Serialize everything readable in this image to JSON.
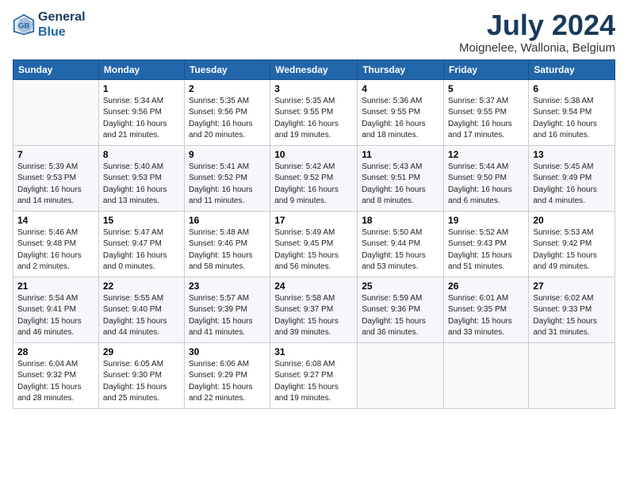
{
  "header": {
    "logo_line1": "General",
    "logo_line2": "Blue",
    "title": "July 2024",
    "location": "Moignelee, Wallonia, Belgium"
  },
  "columns": [
    "Sunday",
    "Monday",
    "Tuesday",
    "Wednesday",
    "Thursday",
    "Friday",
    "Saturday"
  ],
  "weeks": [
    [
      {
        "day": "",
        "info": ""
      },
      {
        "day": "1",
        "info": "Sunrise: 5:34 AM\nSunset: 9:56 PM\nDaylight: 16 hours\nand 21 minutes."
      },
      {
        "day": "2",
        "info": "Sunrise: 5:35 AM\nSunset: 9:56 PM\nDaylight: 16 hours\nand 20 minutes."
      },
      {
        "day": "3",
        "info": "Sunrise: 5:35 AM\nSunset: 9:55 PM\nDaylight: 16 hours\nand 19 minutes."
      },
      {
        "day": "4",
        "info": "Sunrise: 5:36 AM\nSunset: 9:55 PM\nDaylight: 16 hours\nand 18 minutes."
      },
      {
        "day": "5",
        "info": "Sunrise: 5:37 AM\nSunset: 9:55 PM\nDaylight: 16 hours\nand 17 minutes."
      },
      {
        "day": "6",
        "info": "Sunrise: 5:38 AM\nSunset: 9:54 PM\nDaylight: 16 hours\nand 16 minutes."
      }
    ],
    [
      {
        "day": "7",
        "info": "Sunrise: 5:39 AM\nSunset: 9:53 PM\nDaylight: 16 hours\nand 14 minutes."
      },
      {
        "day": "8",
        "info": "Sunrise: 5:40 AM\nSunset: 9:53 PM\nDaylight: 16 hours\nand 13 minutes."
      },
      {
        "day": "9",
        "info": "Sunrise: 5:41 AM\nSunset: 9:52 PM\nDaylight: 16 hours\nand 11 minutes."
      },
      {
        "day": "10",
        "info": "Sunrise: 5:42 AM\nSunset: 9:52 PM\nDaylight: 16 hours\nand 9 minutes."
      },
      {
        "day": "11",
        "info": "Sunrise: 5:43 AM\nSunset: 9:51 PM\nDaylight: 16 hours\nand 8 minutes."
      },
      {
        "day": "12",
        "info": "Sunrise: 5:44 AM\nSunset: 9:50 PM\nDaylight: 16 hours\nand 6 minutes."
      },
      {
        "day": "13",
        "info": "Sunrise: 5:45 AM\nSunset: 9:49 PM\nDaylight: 16 hours\nand 4 minutes."
      }
    ],
    [
      {
        "day": "14",
        "info": "Sunrise: 5:46 AM\nSunset: 9:48 PM\nDaylight: 16 hours\nand 2 minutes."
      },
      {
        "day": "15",
        "info": "Sunrise: 5:47 AM\nSunset: 9:47 PM\nDaylight: 16 hours\nand 0 minutes."
      },
      {
        "day": "16",
        "info": "Sunrise: 5:48 AM\nSunset: 9:46 PM\nDaylight: 15 hours\nand 58 minutes."
      },
      {
        "day": "17",
        "info": "Sunrise: 5:49 AM\nSunset: 9:45 PM\nDaylight: 15 hours\nand 56 minutes."
      },
      {
        "day": "18",
        "info": "Sunrise: 5:50 AM\nSunset: 9:44 PM\nDaylight: 15 hours\nand 53 minutes."
      },
      {
        "day": "19",
        "info": "Sunrise: 5:52 AM\nSunset: 9:43 PM\nDaylight: 15 hours\nand 51 minutes."
      },
      {
        "day": "20",
        "info": "Sunrise: 5:53 AM\nSunset: 9:42 PM\nDaylight: 15 hours\nand 49 minutes."
      }
    ],
    [
      {
        "day": "21",
        "info": "Sunrise: 5:54 AM\nSunset: 9:41 PM\nDaylight: 15 hours\nand 46 minutes."
      },
      {
        "day": "22",
        "info": "Sunrise: 5:55 AM\nSunset: 9:40 PM\nDaylight: 15 hours\nand 44 minutes."
      },
      {
        "day": "23",
        "info": "Sunrise: 5:57 AM\nSunset: 9:39 PM\nDaylight: 15 hours\nand 41 minutes."
      },
      {
        "day": "24",
        "info": "Sunrise: 5:58 AM\nSunset: 9:37 PM\nDaylight: 15 hours\nand 39 minutes."
      },
      {
        "day": "25",
        "info": "Sunrise: 5:59 AM\nSunset: 9:36 PM\nDaylight: 15 hours\nand 36 minutes."
      },
      {
        "day": "26",
        "info": "Sunrise: 6:01 AM\nSunset: 9:35 PM\nDaylight: 15 hours\nand 33 minutes."
      },
      {
        "day": "27",
        "info": "Sunrise: 6:02 AM\nSunset: 9:33 PM\nDaylight: 15 hours\nand 31 minutes."
      }
    ],
    [
      {
        "day": "28",
        "info": "Sunrise: 6:04 AM\nSunset: 9:32 PM\nDaylight: 15 hours\nand 28 minutes."
      },
      {
        "day": "29",
        "info": "Sunrise: 6:05 AM\nSunset: 9:30 PM\nDaylight: 15 hours\nand 25 minutes."
      },
      {
        "day": "30",
        "info": "Sunrise: 6:06 AM\nSunset: 9:29 PM\nDaylight: 15 hours\nand 22 minutes."
      },
      {
        "day": "31",
        "info": "Sunrise: 6:08 AM\nSunset: 9:27 PM\nDaylight: 15 hours\nand 19 minutes."
      },
      {
        "day": "",
        "info": ""
      },
      {
        "day": "",
        "info": ""
      },
      {
        "day": "",
        "info": ""
      }
    ]
  ]
}
